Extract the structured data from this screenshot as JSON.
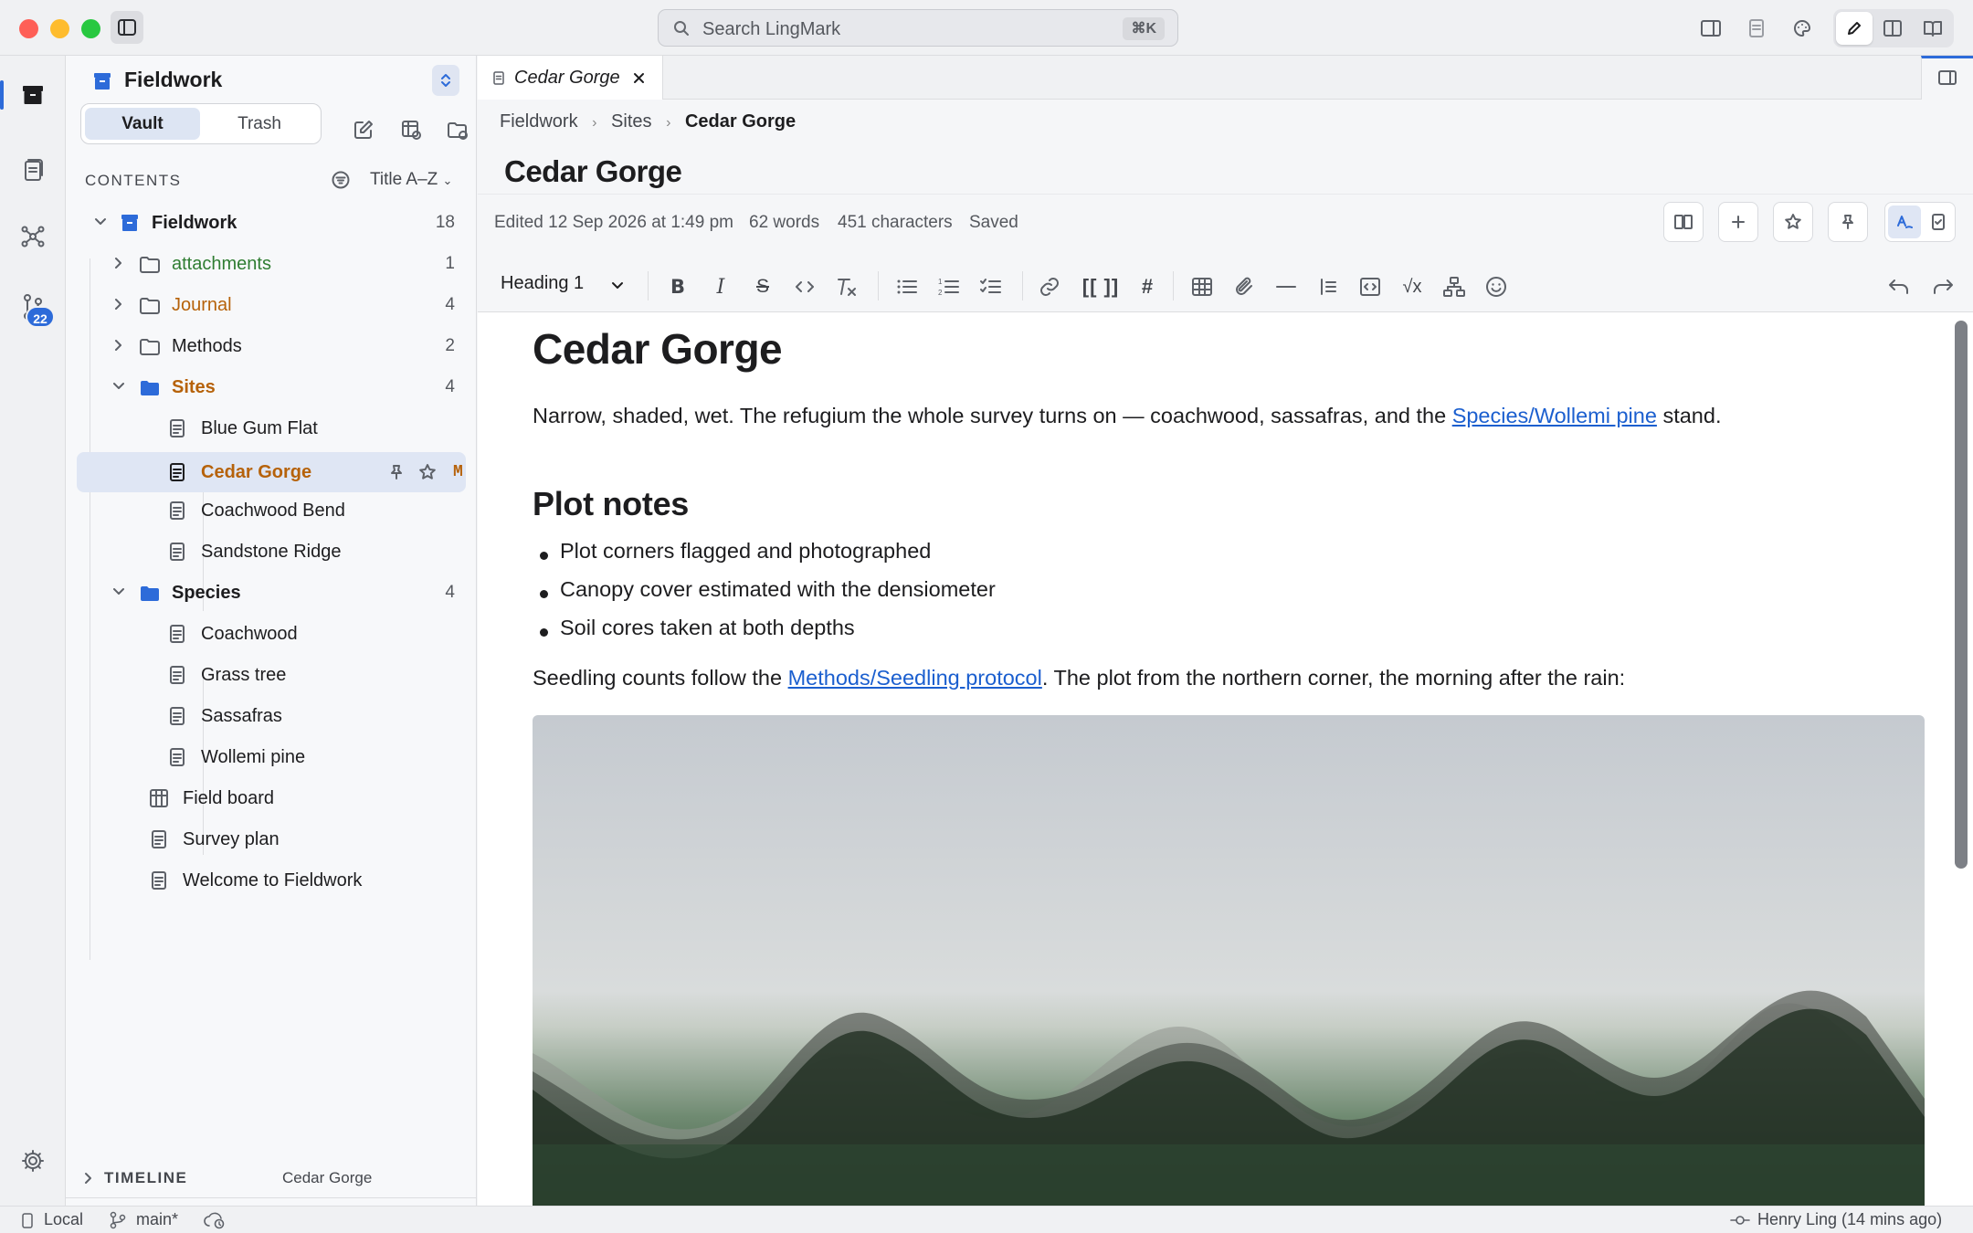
{
  "window": {
    "search_placeholder": "Search LingMark",
    "search_shortcut": "⌘K"
  },
  "activity": {
    "branch_badge": "22"
  },
  "sidebar": {
    "vault_name": "Fieldwork",
    "segments": {
      "vault": "Vault",
      "trash": "Trash"
    },
    "contents_label": "CONTENTS",
    "sort_label": "Title A–Z",
    "tree": {
      "root": {
        "label": "Fieldwork",
        "count": "18"
      },
      "attachments": {
        "label": "attachments",
        "count": "1"
      },
      "journal": {
        "label": "Journal",
        "count": "4"
      },
      "methods": {
        "label": "Methods",
        "count": "2"
      },
      "sites": {
        "label": "Sites",
        "count": "4"
      },
      "blue_gum_flat": "Blue Gum Flat",
      "cedar_gorge": "Cedar Gorge",
      "cedar_gorge_status": "M",
      "coachwood_bend": "Coachwood Bend",
      "sandstone_ridge": "Sandstone Ridge",
      "species": {
        "label": "Species",
        "count": "4"
      },
      "coachwood": "Coachwood",
      "grass_tree": "Grass tree",
      "sassafras": "Sassafras",
      "wollemi_pine": "Wollemi pine",
      "field_board": "Field board",
      "survey_plan": "Survey plan",
      "welcome": "Welcome to Fieldwork"
    },
    "timeline_label": "TIMELINE",
    "timeline_note": "Cedar Gorge"
  },
  "editor": {
    "tab_title": "Cedar Gorge",
    "breadcrumb": {
      "a": "Fieldwork",
      "b": "Sites",
      "c": "Cedar Gorge"
    },
    "note_title": "Cedar Gorge",
    "meta": {
      "edited": "Edited 12 Sep 2026 at 1:49 pm",
      "words": "62 words",
      "characters": "451 characters",
      "saved": "Saved"
    },
    "heading_select": "Heading 1",
    "wiki_link_button": "[[ ]]",
    "hash_button": "#",
    "sqrt_button": "√x"
  },
  "document": {
    "h1": "Cedar Gorge",
    "p1_before": "Narrow, shaded, wet. The refugium the whole survey turns on — coachwood, sassafras, and the ",
    "p1_link": "Species/Wollemi pine",
    "p1_after": " stand.",
    "h2": "Plot notes",
    "bullets": [
      "Plot corners flagged and photographed",
      "Canopy cover estimated with the densiometer",
      "Soil cores taken at both depths"
    ],
    "p2_before": "Seedling counts follow the ",
    "p2_link": "Methods/Seedling protocol",
    "p2_after": ". The plot from the northern corner, the morning after the rain:"
  },
  "status": {
    "local": "Local",
    "branch": "main*",
    "author": "Henry Ling (14 mins ago)"
  },
  "colors": {
    "folder_green": "#2f7d32",
    "folder_orange": "#b6620a",
    "folder_blue": "#2d6bd9",
    "link": "#1b5fcf",
    "selected_row": "#dfe6f4"
  }
}
